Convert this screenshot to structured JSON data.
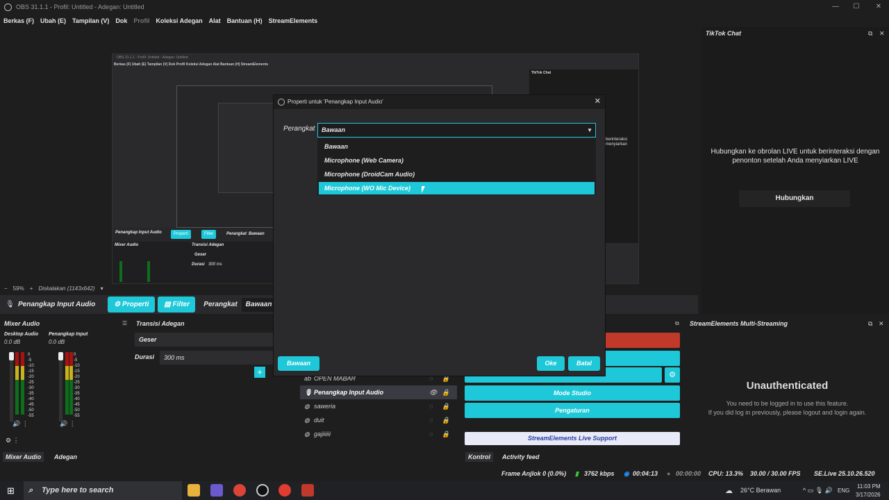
{
  "window": {
    "title": "OBS 31.1.1 - Profil: Untitled - Adegan: Untitled"
  },
  "menu": [
    "Berkas (F)",
    "Ubah (E)",
    "Tampilan (V)",
    "Dok",
    "Profil",
    "Koleksi Adegan",
    "Alat",
    "Bantuan (H)",
    "StreamElements"
  ],
  "preview": {
    "zoom": "59%",
    "scale_label": "Diskalakan (1143x642)",
    "inner_title": "OBS 31.1.1 - Profil: Untitled - Adegan: Untitled",
    "inner_menu": "Berkas (F)  Ubah (E)  Tampilan (V)  Dok  Profil  Koleksi Adegan  Alat  Bantuan (H)  StreamElements",
    "inner_chat_title": "TikTok Chat",
    "inner_chat_text": "berinteraksi\nmenyiarkan",
    "inner_source": "Penangkap Input Audio",
    "inner_props": "Properti",
    "inner_filter": "Filter",
    "inner_device_label": "Perangkat",
    "inner_device_value": "Bawaan",
    "inner_mixer": "Mixer Audio",
    "inner_transition": "Transisi Adegan",
    "inner_trans_value": "Geser",
    "inner_duration": "Durasi",
    "inner_duration_value": "300 ms"
  },
  "source_bar": {
    "name": "Penangkap Input Audio",
    "properties_label": "Properti",
    "filter_label": "Filter",
    "device_label": "Perangkat",
    "device_value": "Bawaan"
  },
  "mixer": {
    "title": "Mixer Audio",
    "channels": [
      {
        "name": "Desktop Audio",
        "db": "0.0 dB"
      },
      {
        "name": "Penangkap Input",
        "db": "0.0 dB"
      }
    ],
    "scale": [
      "0",
      "-5",
      "-10",
      "-15",
      "-20",
      "-25",
      "-30",
      "-35",
      "-40",
      "-45",
      "-50",
      "-55",
      "-60"
    ]
  },
  "transition": {
    "title": "Transisi Adegan",
    "value": "Geser",
    "duration_label": "Durasi",
    "duration_value": "300 ms"
  },
  "sources": [
    {
      "name": "OPEN MABAR",
      "selected": false
    },
    {
      "name": "Penangkap Input Audio",
      "selected": true
    },
    {
      "name": "saweria",
      "selected": false
    },
    {
      "name": "duit",
      "selected": false
    },
    {
      "name": "gajiiiiii",
      "selected": false
    }
  ],
  "controls": {
    "studio_mode": "Mode Studio",
    "settings": "Pengaturan",
    "support": "StreamElements Live Support"
  },
  "streamelements": {
    "title": "StreamElements Multi-Streaming",
    "heading": "Unauthenticated",
    "msg1": "You need to be logged in to use this feature.",
    "msg2": "If you did log in previously, please logout and login again."
  },
  "tiktok": {
    "title": "TikTok Chat",
    "message": "Hubungkan ke obrolan LIVE untuk berinteraksi dengan penonton setelah Anda menyiarkan LIVE",
    "connect": "Hubungkan"
  },
  "bottom_tabs": {
    "mixer": "Mixer Audio",
    "scene": "Adegan",
    "control": "Kontrol",
    "activity": "Activity feed"
  },
  "status": {
    "dropped": "Frame Anjlok 0 (0.0%)",
    "bitrate": "3762 kbps",
    "stream_time": "00:04:13",
    "rec_time": "00:00:00",
    "cpu": "CPU: 13.3%",
    "fps": "30.00 / 30.00 FPS",
    "version": "SE.Live 25.10.26.520"
  },
  "dialog": {
    "title": "Properti untuk 'Penangkap Input Audio'",
    "device_label": "Perangkat",
    "selected": "Bawaan",
    "options": [
      "Bawaan",
      "Microphone (Web Camera)",
      "Microphone (DroidCam Audio)",
      "Microphone (WO Mic Device)"
    ],
    "defaults_button": "Bawaan",
    "ok_button": "Oke",
    "cancel_button": "Batal"
  },
  "taskbar": {
    "search_placeholder": "Type here to search",
    "weather": "26°C Berawan",
    "lang": "ENG",
    "time": "11:03 PM",
    "date": "3/17/2026"
  }
}
